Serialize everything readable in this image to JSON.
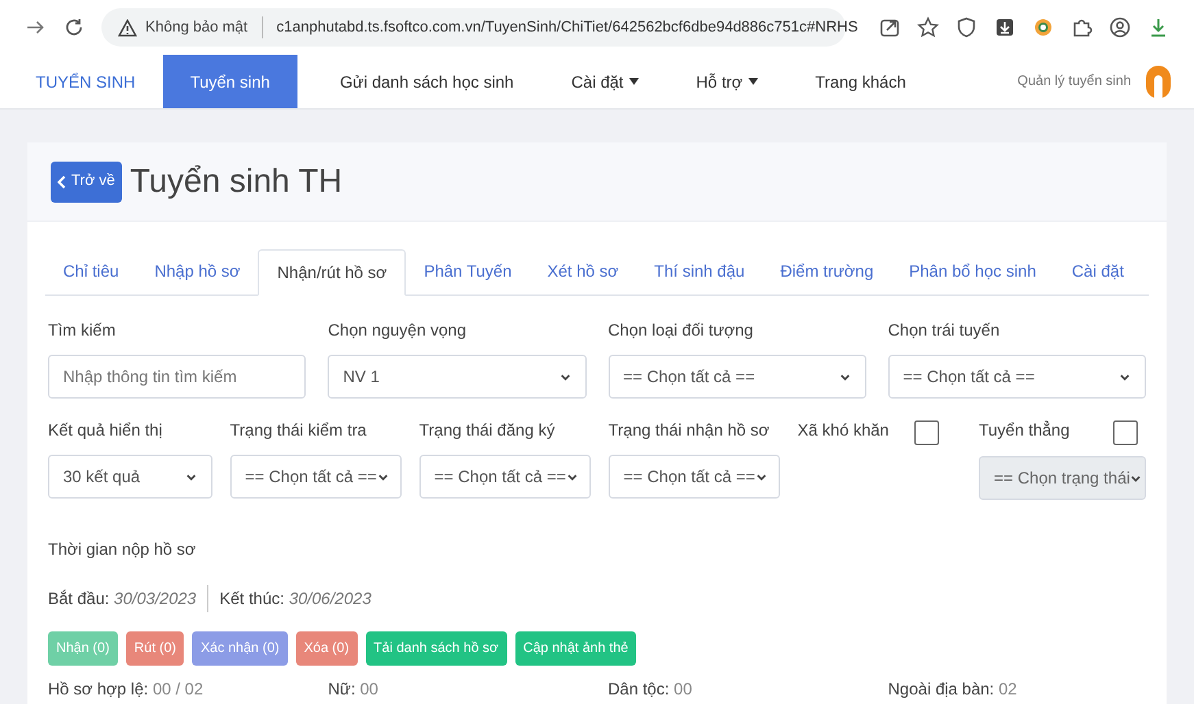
{
  "browser": {
    "security_label": "Không bảo mật",
    "url": "c1anphutabd.ts.fsoftco.com.vn/TuyenSinh/ChiTiet/642562bcf6dbe94d886c751c#NRHS"
  },
  "nav": {
    "brand": "TUYỂN SINH",
    "items": [
      {
        "label": "Tuyển sinh",
        "selected": true,
        "dropdown": false
      },
      {
        "label": "Gửi danh sách học sinh",
        "selected": false,
        "dropdown": false
      },
      {
        "label": "Cài đặt",
        "selected": false,
        "dropdown": true
      },
      {
        "label": "Hỗ trợ",
        "selected": false,
        "dropdown": true
      },
      {
        "label": "Trang khách",
        "selected": false,
        "dropdown": false
      }
    ],
    "user": "Quản lý tuyển sinh"
  },
  "page": {
    "back_button": "Trở về",
    "title": "Tuyển sinh TH"
  },
  "tabs": [
    {
      "label": "Chỉ tiêu",
      "selected": false
    },
    {
      "label": "Nhập hồ sơ",
      "selected": false
    },
    {
      "label": "Nhận/rút hồ sơ",
      "selected": true
    },
    {
      "label": "Phân Tuyến",
      "selected": false
    },
    {
      "label": "Xét hồ sơ",
      "selected": false
    },
    {
      "label": "Thí sinh đậu",
      "selected": false
    },
    {
      "label": "Điểm trường",
      "selected": false
    },
    {
      "label": "Phân bổ học sinh",
      "selected": false
    },
    {
      "label": "Cài đặt",
      "selected": false
    }
  ],
  "filters_row1": [
    {
      "kind": "input",
      "label": "Tìm kiếm",
      "placeholder": "Nhập thông tin tìm kiếm"
    },
    {
      "kind": "select",
      "label": "Chọn nguyện vọng",
      "value": "NV 1"
    },
    {
      "kind": "select",
      "label": "Chọn loại đối tượng",
      "value": "== Chọn tất cả =="
    },
    {
      "kind": "select",
      "label": "Chọn trái tuyến",
      "value": "== Chọn tất cả =="
    }
  ],
  "filters_row2": [
    {
      "kind": "select",
      "label": "Kết quả hiển thị",
      "value": "30 kết quả"
    },
    {
      "kind": "select",
      "label": "Trạng thái kiểm tra",
      "value": "== Chọn tất cả =="
    },
    {
      "kind": "select",
      "label": "Trạng thái đăng ký",
      "value": "== Chọn tất cả =="
    },
    {
      "kind": "select",
      "label": "Trạng thái nhận hồ sơ",
      "value": "== Chọn tất cả =="
    },
    {
      "kind": "checkbox",
      "label": "Xã khó khăn",
      "checked": false
    },
    {
      "kind": "checkbox",
      "label": "Tuyển thẳng",
      "checked": false,
      "select": {
        "value": "== Chọn trạng thái",
        "disabled": true
      }
    }
  ],
  "submission": {
    "title": "Thời gian nộp hồ sơ",
    "start_label": "Bắt đầu:",
    "start": "30/03/2023",
    "end_label": "Kết thúc:",
    "end": "30/06/2023"
  },
  "actions": [
    {
      "label": "Nhận (0)",
      "color": "#6fd0a6"
    },
    {
      "label": "Rút (0)",
      "color": "#e8877a"
    },
    {
      "label": "Xác nhận (0)",
      "color": "#8c9ce6"
    },
    {
      "label": "Xóa (0)",
      "color": "#e8877a"
    },
    {
      "label": "Tải danh sách hồ sơ",
      "color": "#22c384"
    },
    {
      "label": "Cập nhật ảnh thẻ",
      "color": "#22c384"
    }
  ],
  "stats": [
    {
      "label": "Hồ sơ hợp lệ:",
      "value": "00 / 02"
    },
    {
      "label": "Nữ:",
      "value": "00"
    },
    {
      "label": "Dân tộc:",
      "value": "00"
    },
    {
      "label": "Ngoài địa bàn:",
      "value": "02"
    }
  ]
}
